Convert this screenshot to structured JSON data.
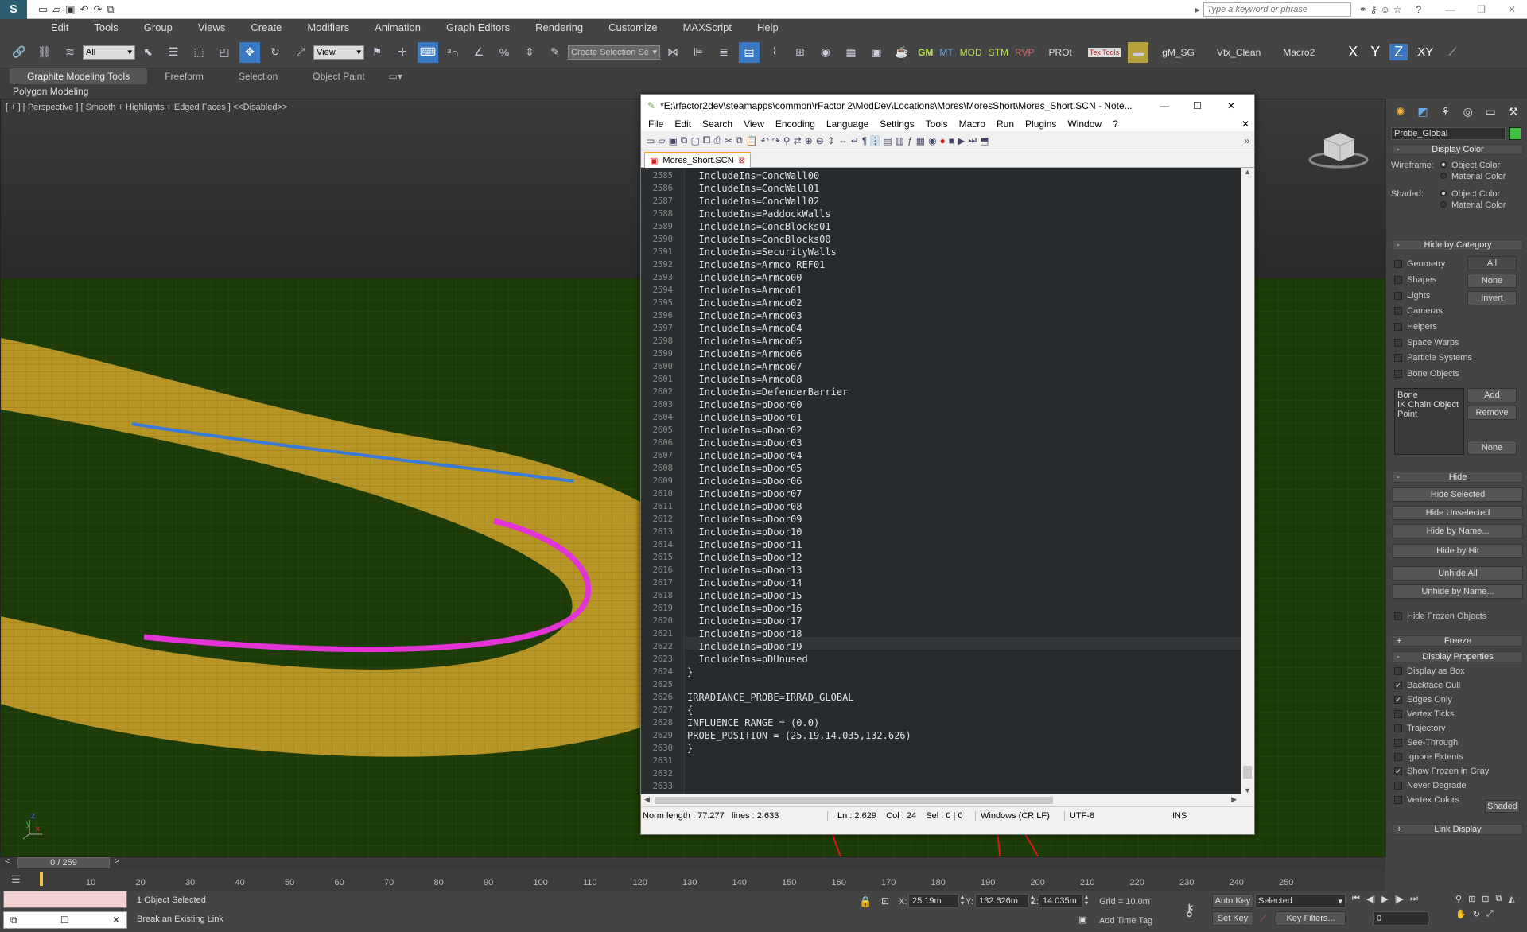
{
  "app": {
    "search_placeholder": "Type a keyword or phrase"
  },
  "menu": [
    "Edit",
    "Tools",
    "Group",
    "Views",
    "Create",
    "Modifiers",
    "Animation",
    "Graph Editors",
    "Rendering",
    "Customize",
    "MAXScript",
    "Help"
  ],
  "toolbar": {
    "selection_filter": "All",
    "ref_coord": "View",
    "selection_set": "Create Selection Se",
    "custom_buttons": [
      "GM",
      "MT",
      "MOD",
      "STM",
      "RVP",
      "PROt",
      "Tex Tools",
      "gM_SG",
      "Vtx_Clean",
      "Macro2"
    ],
    "axes": [
      "X",
      "Y",
      "Z",
      "XY"
    ]
  },
  "ribbon": {
    "tabs": [
      "Graphite Modeling Tools",
      "Freeform",
      "Selection",
      "Object Paint"
    ],
    "panel_label": "Polygon Modeling"
  },
  "viewport": {
    "label": "[ + ] [ Perspective ] [ Smooth + Highlights + Edged Faces ] <<Disabled>>",
    "axis_labels": [
      "x",
      "y",
      "z"
    ]
  },
  "command_panel": {
    "object_name": "Probe_Global",
    "object_color": "#3ec13e",
    "display_color": {
      "title": "Display Color",
      "wireframe_label": "Wireframe:",
      "shaded_label": "Shaded:",
      "options": [
        "Object Color",
        "Material Color"
      ]
    },
    "hide_by_category": {
      "title": "Hide by Category",
      "items": [
        "Geometry",
        "Shapes",
        "Lights",
        "Cameras",
        "Helpers",
        "Space Warps",
        "Particle Systems",
        "Bone Objects"
      ],
      "buttons": [
        "All",
        "None",
        "Invert"
      ],
      "list": [
        "Bone",
        "IK Chain Object",
        "Point"
      ],
      "list_buttons": [
        "Add",
        "Remove",
        "None"
      ]
    },
    "hide": {
      "title": "Hide",
      "buttons": [
        "Hide Selected",
        "Hide Unselected",
        "Hide by Name...",
        "Hide by Hit",
        "Unhide All",
        "Unhide by Name..."
      ],
      "frozen_label": "Hide Frozen Objects"
    },
    "freeze_title": "Freeze",
    "display_properties": {
      "title": "Display Properties",
      "items": [
        {
          "label": "Display as Box",
          "checked": false
        },
        {
          "label": "Backface Cull",
          "checked": true
        },
        {
          "label": "Edges Only",
          "checked": true
        },
        {
          "label": "Vertex Ticks",
          "checked": false
        },
        {
          "label": "Trajectory",
          "checked": false
        },
        {
          "label": "See-Through",
          "checked": false
        },
        {
          "label": "Ignore Extents",
          "checked": false
        },
        {
          "label": "Show Frozen in Gray",
          "checked": true
        },
        {
          "label": "Never Degrade",
          "checked": false
        },
        {
          "label": "Vertex Colors",
          "checked": false
        }
      ],
      "shaded_button": "Shaded"
    },
    "link_display_title": "Link Display"
  },
  "notepad": {
    "title": "*E:\\rfactor2dev\\steamapps\\common\\rFactor 2\\ModDev\\Locations\\Mores\\MoresShort\\Mores_Short.SCN - Note...",
    "menu": [
      "File",
      "Edit",
      "Search",
      "View",
      "Encoding",
      "Language",
      "Settings",
      "Tools",
      "Macro",
      "Run",
      "Plugins",
      "Window",
      "?"
    ],
    "tab": "Mores_Short.SCN",
    "lines": [
      {
        "n": "2585",
        "t": "  IncludeIns=ConcWall00"
      },
      {
        "n": "2586",
        "t": "  IncludeIns=ConcWall01"
      },
      {
        "n": "2587",
        "t": "  IncludeIns=ConcWall02"
      },
      {
        "n": "2588",
        "t": "  IncludeIns=PaddockWalls"
      },
      {
        "n": "2589",
        "t": "  IncludeIns=ConcBlocks01"
      },
      {
        "n": "2590",
        "t": "  IncludeIns=ConcBlocks00"
      },
      {
        "n": "2591",
        "t": "  IncludeIns=SecurityWalls"
      },
      {
        "n": "2592",
        "t": "  IncludeIns=Armco_REF01"
      },
      {
        "n": "2593",
        "t": "  IncludeIns=Armco00"
      },
      {
        "n": "2594",
        "t": "  IncludeIns=Armco01"
      },
      {
        "n": "2595",
        "t": "  IncludeIns=Armco02"
      },
      {
        "n": "2596",
        "t": "  IncludeIns=Armco03"
      },
      {
        "n": "2597",
        "t": "  IncludeIns=Armco04"
      },
      {
        "n": "2598",
        "t": "  IncludeIns=Armco05"
      },
      {
        "n": "2599",
        "t": "  IncludeIns=Armco06"
      },
      {
        "n": "2600",
        "t": "  IncludeIns=Armco07"
      },
      {
        "n": "2601",
        "t": "  IncludeIns=Armco08"
      },
      {
        "n": "2602",
        "t": "  IncludeIns=DefenderBarrier"
      },
      {
        "n": "2603",
        "t": "  IncludeIns=pDoor00"
      },
      {
        "n": "2604",
        "t": "  IncludeIns=pDoor01"
      },
      {
        "n": "2605",
        "t": "  IncludeIns=pDoor02"
      },
      {
        "n": "2606",
        "t": "  IncludeIns=pDoor03"
      },
      {
        "n": "2607",
        "t": "  IncludeIns=pDoor04"
      },
      {
        "n": "2608",
        "t": "  IncludeIns=pDoor05"
      },
      {
        "n": "2609",
        "t": "  IncludeIns=pDoor06"
      },
      {
        "n": "2610",
        "t": "  IncludeIns=pDoor07"
      },
      {
        "n": "2611",
        "t": "  IncludeIns=pDoor08"
      },
      {
        "n": "2612",
        "t": "  IncludeIns=pDoor09"
      },
      {
        "n": "2613",
        "t": "  IncludeIns=pDoor10"
      },
      {
        "n": "2614",
        "t": "  IncludeIns=pDoor11"
      },
      {
        "n": "2615",
        "t": "  IncludeIns=pDoor12"
      },
      {
        "n": "2616",
        "t": "  IncludeIns=pDoor13"
      },
      {
        "n": "2617",
        "t": "  IncludeIns=pDoor14"
      },
      {
        "n": "2618",
        "t": "  IncludeIns=pDoor15"
      },
      {
        "n": "2619",
        "t": "  IncludeIns=pDoor16"
      },
      {
        "n": "2620",
        "t": "  IncludeIns=pDoor17"
      },
      {
        "n": "2621",
        "t": "  IncludeIns=pDoor18"
      },
      {
        "n": "2622",
        "t": "  IncludeIns=pDoor19"
      },
      {
        "n": "2623",
        "t": "  IncludeIns=pDUnused"
      },
      {
        "n": "2624",
        "t": "}"
      },
      {
        "n": "2625",
        "t": ""
      },
      {
        "n": "2626",
        "t": "IRRADIANCE_PROBE=IRRAD_GLOBAL"
      },
      {
        "n": "2627",
        "t": "{"
      },
      {
        "n": "2628",
        "t": "INFLUENCE_RANGE = (0.0)"
      },
      {
        "n": "2629",
        "t": "PROBE_POSITION = (25.19,14.035,132.626)"
      },
      {
        "n": "2630",
        "t": "}"
      },
      {
        "n": "2631",
        "t": ""
      },
      {
        "n": "2632",
        "t": ""
      },
      {
        "n": "2633",
        "t": ""
      }
    ],
    "status": {
      "length": "Norm length : 77.277",
      "lines": "lines : 2.633",
      "pos": "Ln : 2.629    Col : 24    Sel : 0 | 0",
      "eol": "Windows (CR LF)",
      "encoding": "UTF-8",
      "mode": "INS"
    }
  },
  "timeline": {
    "frame_display": "0 / 259",
    "ticks": [
      "10",
      "20",
      "30",
      "40",
      "50",
      "60",
      "70",
      "80",
      "90",
      "100",
      "110",
      "120",
      "130",
      "140",
      "150",
      "160",
      "170",
      "180",
      "190",
      "200",
      "210",
      "220",
      "230",
      "240",
      "250"
    ]
  },
  "status": {
    "selection": "1 Object Selected",
    "prompt": "Break an Existing Link",
    "x_label": "X:",
    "x": "25.19m",
    "y_label": "Y:",
    "y": "132.626m",
    "z_label": "Z:",
    "z": "14.035m",
    "grid": "Grid = 10.0m",
    "add_time_tag": "Add Time Tag",
    "auto_key": "Auto Key",
    "set_key": "Set Key",
    "key_mode": "Selected",
    "key_filters": "Key Filters...",
    "frame": "0"
  }
}
